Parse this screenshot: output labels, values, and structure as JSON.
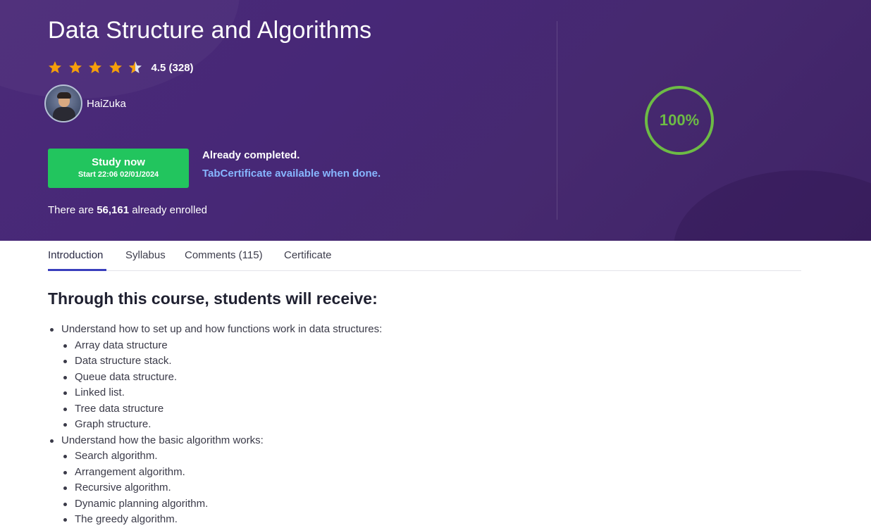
{
  "course": {
    "title": "Data Structure and Algorithms",
    "rating": 4.5,
    "rating_text": "4.5 (328)",
    "author": "HaiZuka",
    "progress_label": "100%",
    "progress_fraction": 1.0
  },
  "study_button": {
    "label": "Study now",
    "start": "Start 22:06 02/01/2024"
  },
  "status": {
    "completed": "Already completed.",
    "certificate": "TabCertificate available when done."
  },
  "enrollment": {
    "prefix": "There are ",
    "count": "56,161",
    "suffix": " already enrolled"
  },
  "tabs": [
    {
      "label": "Introduction",
      "active": true
    },
    {
      "label": "Syllabus",
      "active": false
    },
    {
      "label": "Comments (115)",
      "active": false
    },
    {
      "label": "Certificate",
      "active": false
    }
  ],
  "intro": {
    "heading": "Through this course, students will receive:",
    "groups": [
      {
        "text": "Understand how to set up and how functions work in data structures:",
        "items": [
          "Array data structure",
          "Data structure stack.",
          "Queue data structure.",
          "Linked list.",
          "Tree data structure",
          "Graph structure."
        ]
      },
      {
        "text": "Understand how the basic algorithm works:",
        "items": [
          "Search algorithm.",
          "Arrangement algorithm.",
          "Recursive algorithm.",
          "Dynamic planning algorithm.",
          "The greedy algorithm."
        ]
      }
    ]
  },
  "colors": {
    "hero_bg": "#46296f",
    "button": "#22c55e",
    "progress": "#6dbb45",
    "link": "#87b6ff",
    "tab_active": "#3a3fbd",
    "star": "#f59e0b"
  }
}
